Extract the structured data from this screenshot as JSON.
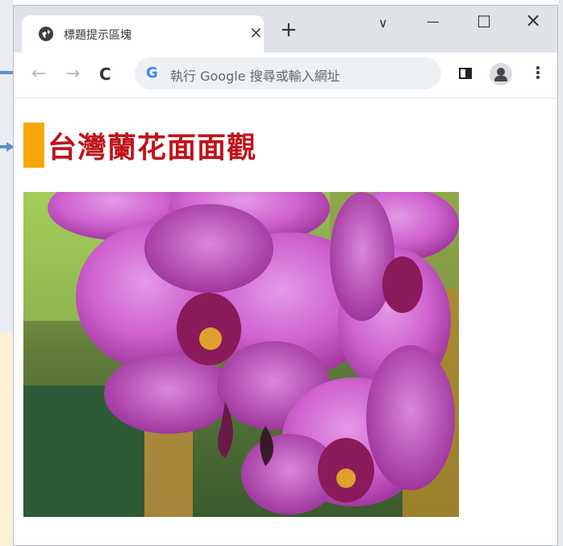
{
  "browser": {
    "tab_title": "標題提示區塊",
    "tab_close": "×",
    "new_tab": "+",
    "window_controls": {
      "dropdown": "∨",
      "minimize": "—",
      "maximize": "☐",
      "close": "×"
    },
    "address_placeholder": "執行 Google 搜尋或輸入網址",
    "google_letter": "G",
    "nav": {
      "back": "←",
      "forward": "→",
      "reload": "C"
    },
    "menu": "⋮"
  },
  "page": {
    "title": "台灣蘭花面面觀",
    "image_alt": "orchid-photo"
  },
  "colors": {
    "title_red": "#c0121a",
    "title_marker": "#f5a70a",
    "titlebar_gray": "#dfe3e8",
    "omnibox_gray": "#eef1f4"
  },
  "icons": [
    "globe-icon",
    "close-icon",
    "plus-icon",
    "chevron-down-icon",
    "minimize-icon",
    "maximize-icon",
    "back-arrow-icon",
    "forward-arrow-icon",
    "reload-icon",
    "google-icon",
    "side-panel-icon",
    "profile-icon",
    "more-menu-icon"
  ]
}
